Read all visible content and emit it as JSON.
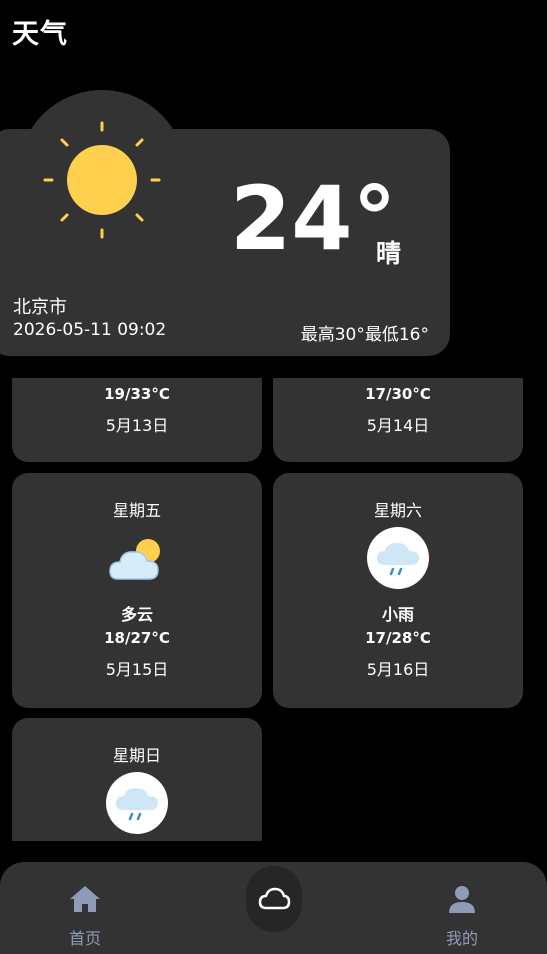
{
  "app": {
    "title": "天气"
  },
  "current": {
    "temperature": "24°",
    "condition": "晴",
    "city": "北京市",
    "datetime": "2026-05-11 09:02",
    "high_low": "最高30°最低16°",
    "icon": "sun-icon"
  },
  "forecast": [
    {
      "range": "19/33°C",
      "date": "5月13日"
    },
    {
      "range": "17/30°C",
      "date": "5月14日"
    },
    {
      "day": "星期五",
      "icon": "partly-cloudy-icon",
      "condition": "多云",
      "range": "18/27°C",
      "date": "5月15日"
    },
    {
      "day": "星期六",
      "icon": "light-rain-icon",
      "condition": "小雨",
      "range": "17/28°C",
      "date": "5月16日"
    },
    {
      "day": "星期日",
      "icon": "light-rain-icon"
    }
  ],
  "nav": {
    "home_label": "首页",
    "mine_label": "我的",
    "active_color": "#8f9bb8"
  },
  "colors": {
    "card": "#333333",
    "background": "#000000",
    "sun": "#ffd04d"
  }
}
